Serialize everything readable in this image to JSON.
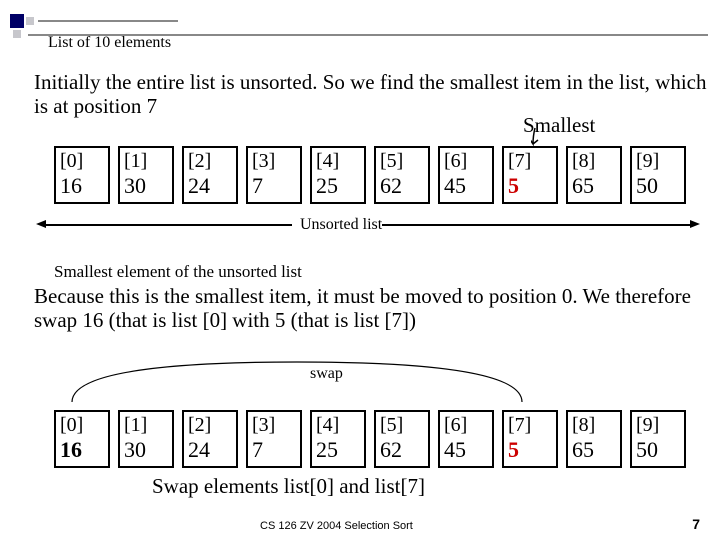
{
  "title": "List of 10 elements",
  "intro_text": "Initially the entire list is unsorted. So we find the smallest item in the list, which is at position 7",
  "smallest_label": "Smallest",
  "unsorted_label": "Unsorted list",
  "smallest_caption": "Smallest element of the unsorted list",
  "explain_text": "Because this is the smallest item, it must be moved to position 0. We therefore swap 16 (that is list [0] with 5 (that is list [7])",
  "swap_label": "swap",
  "swap_caption": "Swap elements list[0] and list[7]",
  "footer": "CS 126   ZV  2004   Selection Sort",
  "page_number": "7",
  "cells": {
    "indices": [
      "[0]",
      "[1]",
      "[2]",
      "[3]",
      "[4]",
      "[5]",
      "[6]",
      "[7]",
      "[8]",
      "[9]"
    ],
    "values": [
      "16",
      "30",
      "24",
      "7",
      "25",
      "62",
      "45",
      "5",
      "65",
      "50"
    ],
    "highlight_index_row1": 7,
    "swap_pair_row2": [
      0,
      7
    ]
  },
  "colors": {
    "highlight": "#cc0000",
    "bullet": "#000066"
  }
}
